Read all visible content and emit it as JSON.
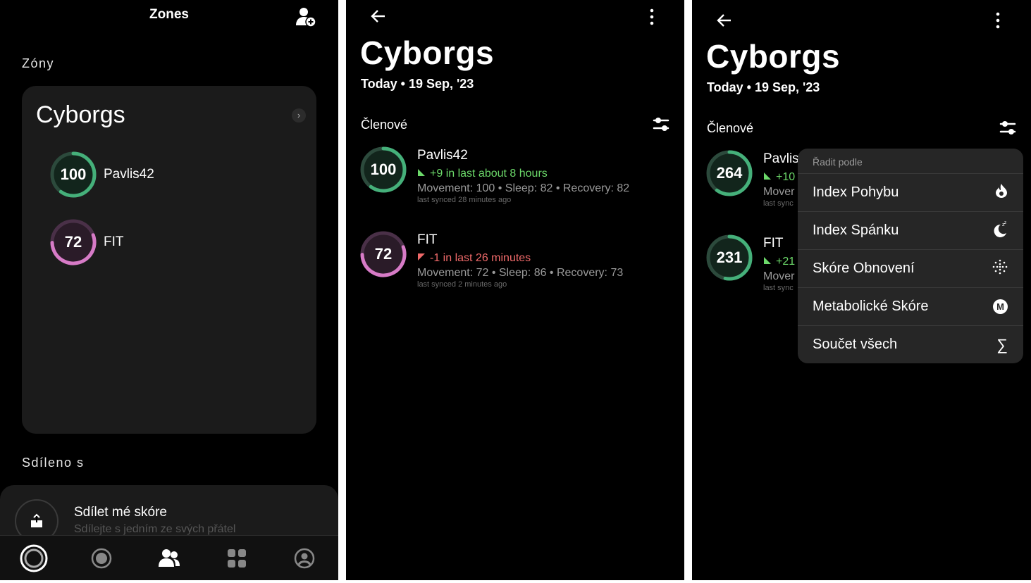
{
  "panel1": {
    "header_title": "Zones",
    "section_zones": "Zóny",
    "zone_card": {
      "title": "Cyborgs",
      "members": [
        {
          "name": "Pavlis42",
          "score": "100",
          "ring_fraction": 0.6,
          "color": "#45b07a"
        },
        {
          "name": "FIT",
          "score": "72",
          "ring_fraction": 0.55,
          "color": "#d77bc7"
        }
      ]
    },
    "section_shared": "Sdíleno s",
    "share": {
      "title": "Sdílet mé skóre",
      "subtitle": "Sdílejte s jedním ze svých přátel"
    },
    "nav": [
      "home-tab",
      "badge-tab",
      "friends-tab",
      "dashboard-tab",
      "profile-tab"
    ]
  },
  "panel2": {
    "title": "Cyborgs",
    "date": "Today • 19 Sep, '23",
    "members_label": "Členové",
    "members": [
      {
        "name": "Pavlis42",
        "score": "100",
        "delta": "+9 in last about 8 hours",
        "stats": "Movement: 100 • Sleep: 82 • Recovery: 82",
        "synced": "last synced 28 minutes ago"
      },
      {
        "name": "FIT",
        "score": "72",
        "delta": "-1 in last 26 minutes",
        "stats": "Movement: 72 • Sleep: 86 • Recovery: 73",
        "synced": "last synced 2 minutes ago"
      }
    ]
  },
  "panel3": {
    "title": "Cyborgs",
    "date": "Today • 19 Sep, '23",
    "members_label": "Členové",
    "members": [
      {
        "name": "Pavlis",
        "score": "264",
        "delta": "+10",
        "stats": "Mover",
        "synced": "last sync"
      },
      {
        "name": "FIT",
        "score": "231",
        "delta": "+21",
        "stats": "Mover",
        "synced": "last sync"
      }
    ],
    "sort_menu": {
      "heading": "Řadit podle",
      "items": [
        {
          "label": "Index Pohybu",
          "icon": "flame-icon"
        },
        {
          "label": "Index Spánku",
          "icon": "moon-icon"
        },
        {
          "label": "Skóre Obnovení",
          "icon": "dots-icon"
        },
        {
          "label": "Metabolické Skóre",
          "icon": "m-circle-icon",
          "glyph": "M"
        },
        {
          "label": "Součet všech",
          "icon": "sigma-icon",
          "glyph": "∑"
        }
      ]
    }
  }
}
